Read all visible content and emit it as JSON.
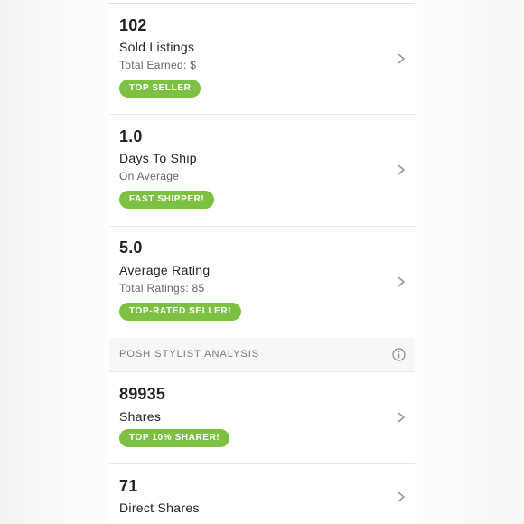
{
  "stats": [
    {
      "value": "102",
      "title": "Sold Listings",
      "subtitle": "Total Earned: $",
      "badge": "TOP SELLER"
    },
    {
      "value": "1.0",
      "title": "Days To Ship",
      "subtitle": "On Average",
      "badge": "FAST SHIPPER!"
    },
    {
      "value": "5.0",
      "title": "Average Rating",
      "subtitle": "Total Ratings: 85",
      "badge": "TOP-RATED SELLER!"
    }
  ],
  "analysis": {
    "section_title": "POSH STYLIST ANALYSIS",
    "items": [
      {
        "value": "89935",
        "title": "Shares",
        "badge": "TOP 10% SHARER!"
      },
      {
        "value": "71",
        "title": "Direct Shares"
      }
    ]
  },
  "colors": {
    "badge_green": "#7dc142",
    "text_primary": "#222222",
    "text_secondary": "#666666"
  },
  "icons": {
    "row_chevron": "chevron-right-icon",
    "section_info": "info-icon"
  }
}
